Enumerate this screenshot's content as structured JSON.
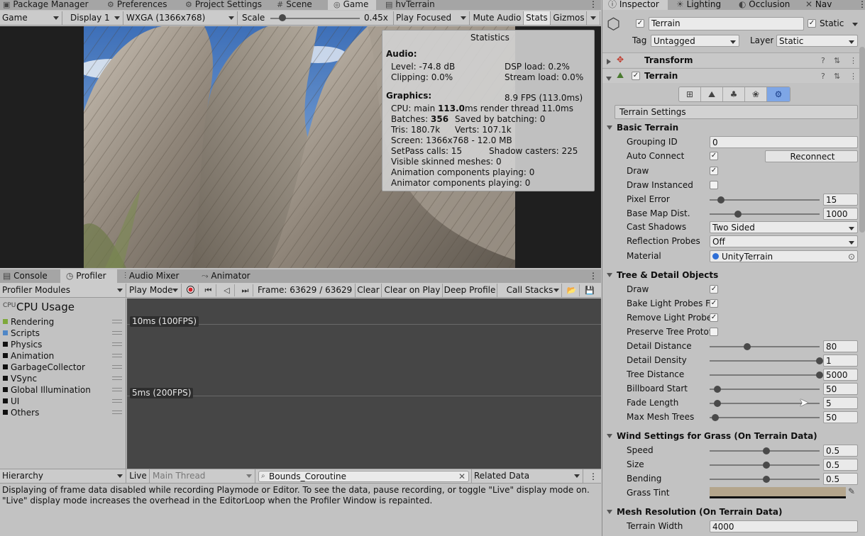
{
  "top_tabs": [
    {
      "label": "Package Manager",
      "icon": "package-icon"
    },
    {
      "label": "Preferences",
      "icon": "gear-icon"
    },
    {
      "label": "Project Settings",
      "icon": "gear-icon"
    },
    {
      "label": "Scene",
      "icon": "scene-icon"
    },
    {
      "label": "Game",
      "icon": "game-icon"
    },
    {
      "label": "hvTerrain",
      "icon": "terrain-icon"
    }
  ],
  "game_toolbar": {
    "view": "Game",
    "display": "Display 1",
    "resolution": "WXGA (1366x768)",
    "scale_label": "Scale",
    "scale_value": "0.45x",
    "scale_fraction": 0.1,
    "play_mode": "Play Focused",
    "mute": "Mute Audio",
    "stats": "Stats",
    "gizmos": "Gizmos"
  },
  "statistics": {
    "title": "Statistics",
    "audio_header": "Audio:",
    "level": "Level: -74.8 dB",
    "clipping": "Clipping: 0.0%",
    "dsp": "DSP load: 0.2%",
    "stream": "Stream load: 0.0%",
    "graphics_header": "Graphics:",
    "fps": "8.9 FPS (113.0ms)",
    "cpu_prefix": "CPU: main ",
    "cpu_main": "113.0",
    "cpu_suffix": "ms  render thread 11.0ms",
    "batches_prefix": "Batches: ",
    "batches": "356",
    "saved": "Saved by batching: 0",
    "tris": "Tris: 180.7k",
    "verts": "Verts: 107.1k",
    "screen": "Screen: 1366x768 - 12.0 MB",
    "setpass": "SetPass calls: 15",
    "shadow": "Shadow casters: 225",
    "skinned": "Visible skinned meshes: 0",
    "anim": "Animation components playing: 0",
    "animator": "Animator components playing: 0"
  },
  "profiler_tabs": [
    {
      "label": "Console"
    },
    {
      "label": "Profiler"
    },
    {
      "label": "Audio Mixer"
    },
    {
      "label": "Animator"
    }
  ],
  "profiler_toolbar": {
    "modules": "Profiler Modules",
    "play_mode": "Play Mode",
    "frame": "Frame: 63629 / 63629",
    "clear": "Clear",
    "clear_on_play": "Clear on Play",
    "deep_profile": "Deep Profile",
    "call_stacks": "Call Stacks"
  },
  "cpu_usage": {
    "title": "CPU Usage",
    "items": [
      {
        "label": "Rendering",
        "color": "#7ea83a"
      },
      {
        "label": "Scripts",
        "color": "#4f87c7"
      },
      {
        "label": "Physics",
        "color": "#111111"
      },
      {
        "label": "Animation",
        "color": "#111111"
      },
      {
        "label": "GarbageCollector",
        "color": "#111111"
      },
      {
        "label": "VSync",
        "color": "#111111"
      },
      {
        "label": "Global Illumination",
        "color": "#111111"
      },
      {
        "label": "UI",
        "color": "#111111"
      },
      {
        "label": "Others",
        "color": "#111111"
      }
    ],
    "marker_10ms": "10ms (100FPS)",
    "marker_5ms": "5ms (200FPS)"
  },
  "hierarchy_bar": {
    "view": "Hierarchy",
    "live": "Live",
    "thread": "Main Thread",
    "search": "Bounds_Coroutine",
    "related": "Related Data"
  },
  "message": {
    "line1": "Displaying of frame data disabled while recording Playmode or Editor. To see the data, pause recording, or toggle \"Live\" display mode on.",
    "line2": " \"Live\" display mode increases the overhead in the EditorLoop when the Profiler Window is repainted."
  },
  "inspector_tabs": [
    {
      "label": "Inspector"
    },
    {
      "label": "Lighting"
    },
    {
      "label": "Occlusion"
    },
    {
      "label": "Nav"
    }
  ],
  "object": {
    "name": "Terrain",
    "static_label": "Static",
    "tag_label": "Tag",
    "tag": "Untagged",
    "layer_label": "Layer",
    "layer": "Static"
  },
  "components": {
    "transform": "Transform",
    "terrain": "Terrain"
  },
  "terrain_settings": "Terrain Settings",
  "basic": {
    "header": "Basic Terrain",
    "grouping_id": {
      "label": "Grouping ID",
      "value": "0"
    },
    "auto_connect": {
      "label": "Auto Connect"
    },
    "reconnect": "Reconnect",
    "draw": {
      "label": "Draw"
    },
    "draw_instanced": {
      "label": "Draw Instanced"
    },
    "pixel_error": {
      "label": "Pixel Error",
      "value": "15",
      "fraction": 0.07
    },
    "base_map": {
      "label": "Base Map Dist.",
      "value": "1000",
      "fraction": 0.23
    },
    "cast_shadows": {
      "label": "Cast Shadows",
      "value": "Two Sided"
    },
    "reflection": {
      "label": "Reflection Probes",
      "value": "Off"
    },
    "material": {
      "label": "Material",
      "value": "UnityTerrain"
    }
  },
  "tree": {
    "header": "Tree & Detail Objects",
    "draw": {
      "label": "Draw"
    },
    "bake": {
      "label": "Bake Light Probes Fo"
    },
    "remove": {
      "label": "Remove Light Probe"
    },
    "preserve": {
      "label": "Preserve Tree Protot"
    },
    "detail_distance": {
      "label": "Detail Distance",
      "value": "80",
      "fraction": 0.32
    },
    "detail_density": {
      "label": "Detail Density",
      "value": "1",
      "fraction": 1.0
    },
    "tree_distance": {
      "label": "Tree Distance",
      "value": "5000",
      "fraction": 1.0
    },
    "billboard": {
      "label": "Billboard Start",
      "value": "50",
      "fraction": 0.04
    },
    "fade": {
      "label": "Fade Length",
      "value": "5",
      "fraction": 0.04
    },
    "max_mesh": {
      "label": "Max Mesh Trees",
      "value": "50",
      "fraction": 0.02
    }
  },
  "wind": {
    "header": "Wind Settings for Grass (On Terrain Data)",
    "speed": {
      "label": "Speed",
      "value": "0.5",
      "fraction": 0.5
    },
    "size": {
      "label": "Size",
      "value": "0.5",
      "fraction": 0.5
    },
    "bending": {
      "label": "Bending",
      "value": "0.5",
      "fraction": 0.5
    },
    "grass_tint": {
      "label": "Grass Tint",
      "color": "#b4a58c"
    }
  },
  "mesh": {
    "header": "Mesh Resolution (On Terrain Data)",
    "width": {
      "label": "Terrain Width",
      "value": "4000"
    }
  },
  "colors": {
    "accent": "#3f6fd0",
    "panel": "#c2c2c2",
    "graph": "#464646"
  }
}
